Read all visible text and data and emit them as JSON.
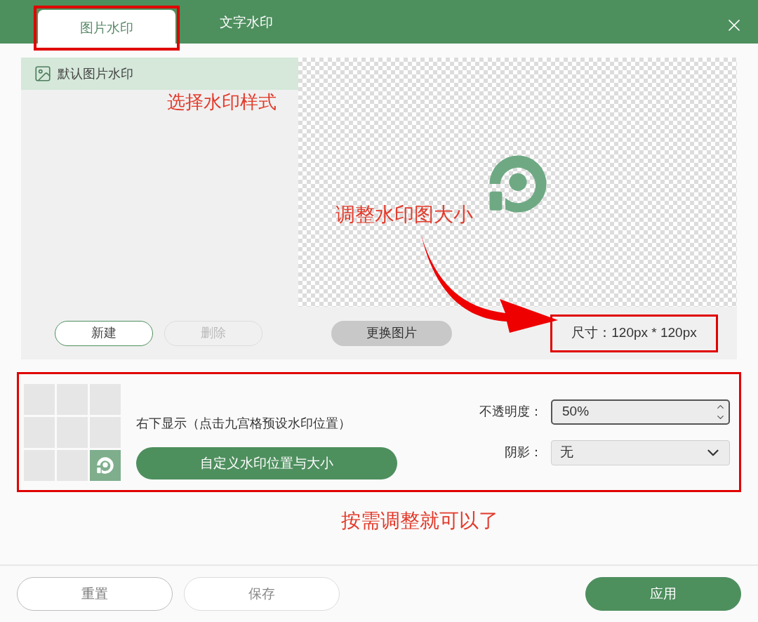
{
  "tabs": [
    {
      "label": "图片水印",
      "selected": true,
      "highlighted": true
    },
    {
      "label": "文字水印",
      "selected": false,
      "highlighted": false
    }
  ],
  "style_list": {
    "items": [
      {
        "label": "默认图片水印",
        "selected": true
      }
    ],
    "buttons": [
      {
        "label": "新建",
        "disabled": false
      },
      {
        "label": "删除",
        "disabled": true
      }
    ]
  },
  "preview": {
    "replace_button": "更换图片",
    "size": "尺寸：120px * 120px"
  },
  "position": {
    "cells": [
      {
        "selected": false
      },
      {
        "selected": false
      },
      {
        "selected": false
      },
      {
        "selected": false
      },
      {
        "selected": false
      },
      {
        "selected": false
      },
      {
        "selected": false
      },
      {
        "selected": false
      },
      {
        "selected": true
      }
    ],
    "description": "右下显示（点击九宫格预设水印位置）",
    "custom_button": "自定义水印位置与大小"
  },
  "opacity": {
    "label": "不透明度：",
    "value": "50%"
  },
  "shadow": {
    "label": "阴影：",
    "value": "无"
  },
  "annotations": [
    "选择水印样式",
    "调整水印图大小",
    "按需调整就可以了"
  ],
  "footer_buttons": [
    {
      "label": "重置",
      "kind": "secondary"
    },
    {
      "label": "保存",
      "kind": "muted"
    },
    {
      "label": "应用",
      "kind": "primary"
    }
  ]
}
